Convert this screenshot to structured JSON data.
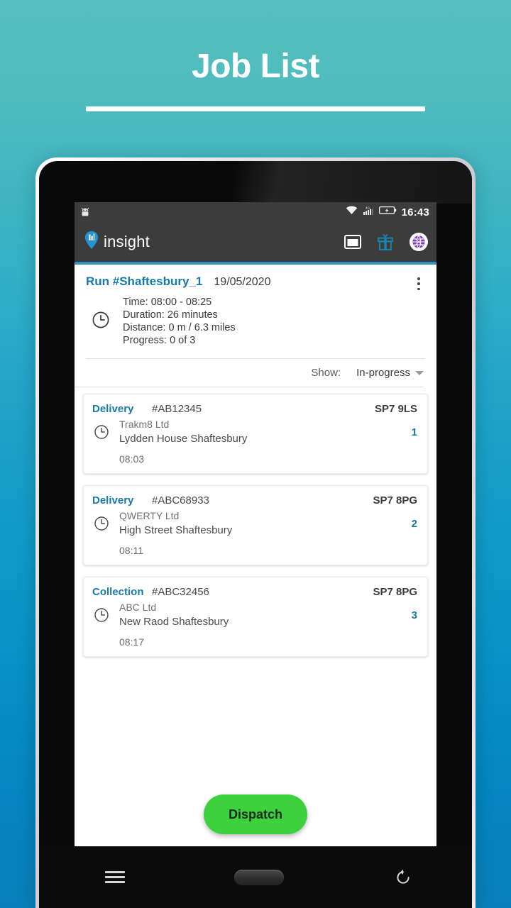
{
  "page": {
    "title": "Job List"
  },
  "device": {
    "statusbar": {
      "time": "16:43",
      "icons": [
        "android-robot-icon",
        "wifi-icon",
        "cellular-4g-icon",
        "battery-charging-icon"
      ]
    },
    "navbar": {
      "back_label": "Back",
      "home_label": "Home",
      "recents_label": "Recent apps"
    },
    "hardware": {
      "menu_label": "Menu",
      "home_label": "Home",
      "back_label": "Back"
    }
  },
  "appbar": {
    "brand": "insight",
    "logo_icon": "insight-pin-logo-icon",
    "actions": [
      {
        "name": "window-icon",
        "label": "Window"
      },
      {
        "name": "gift-icon",
        "label": "Offers"
      },
      {
        "name": "globe-avatar-icon",
        "label": "Account"
      }
    ],
    "accent_color": "#2d93c4"
  },
  "run": {
    "name": "Run #Shaftesbury_1",
    "date": "19/05/2020",
    "clock_icon": "clock-icon",
    "menu_icon": "kebab-menu-icon",
    "details": {
      "time": "Time: 08:00 - 08:25",
      "duration": "Duration: 26 minutes",
      "distance": "Distance: 0 m / 6.3 miles",
      "progress": "Progress: 0 of 3"
    }
  },
  "filter": {
    "label": "Show:",
    "value": "In-progress",
    "caret_icon": "chevron-down-icon",
    "options": [
      "In-progress"
    ]
  },
  "jobs": [
    {
      "type": "Delivery",
      "reference": "#AB12345",
      "postcode": "SP7 9LS",
      "company": "Trakm8 Ltd",
      "address": "Lydden House Shaftesbury",
      "sequence": "1",
      "time": "08:03",
      "clock_icon": "clock-icon"
    },
    {
      "type": "Delivery",
      "reference": "#ABC68933",
      "postcode": "SP7 8PG",
      "company": "QWERTY Ltd",
      "address": "High Street Shaftesbury",
      "sequence": "2",
      "time": "08:11",
      "clock_icon": "clock-icon"
    },
    {
      "type": "Collection",
      "reference": "#ABC32456",
      "postcode": "SP7 8PG",
      "company": "ABC Ltd",
      "address": "New Raod Shaftesbury",
      "sequence": "3",
      "time": "08:17",
      "clock_icon": "clock-icon"
    }
  ],
  "dispatch": {
    "label": "Dispatch",
    "color": "#3ed13e"
  },
  "colors": {
    "brand_blue": "#1679a8",
    "accent_blue": "#2d93c4",
    "gift_teal": "#1785ae",
    "globe_purple": "#7b3fb8",
    "bg_top": "#54bfbc",
    "bg_bottom": "#0b7fbb"
  }
}
